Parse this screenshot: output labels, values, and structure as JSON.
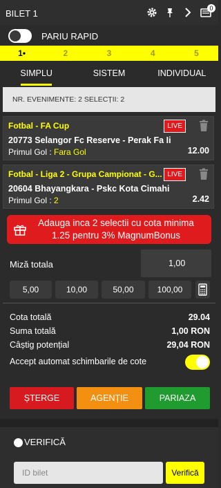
{
  "header": {
    "title": "BILET 1",
    "badge": "0"
  },
  "rapid": {
    "label": "PARIU RAPID",
    "on": false
  },
  "steps": [
    "1•",
    "2",
    "3",
    "4",
    "5"
  ],
  "tabs": [
    "SIMPLU",
    "SISTEM",
    "INDIVIDUAL"
  ],
  "summary": "NR. EVENIMENTE: 2   SELECȚII: 2",
  "bets": [
    {
      "competition": "Fotbal - FA Cup",
      "live": "LIVE",
      "match": "20773  Selangor Fc Reserve  -  Perak Fa Ii",
      "market": "Primul Gol :",
      "selection": "Fara Gol",
      "odd": "12.00"
    },
    {
      "competition": "Fotbal - Liga 2 - Grupa Campionat - G...",
      "live": "LIVE",
      "match": "20604  Bhayangkara  -  Pskc Kota Cimahi",
      "market": "Primul Gol :",
      "selection": "2",
      "odd": "2.42"
    }
  ],
  "promo": {
    "line1": "Adauga inca 2 selectii cu cota minima",
    "line2": "1.25 pentru 3% MagnumBonus"
  },
  "stake": {
    "label": "Miză totala",
    "value": "1,00"
  },
  "quick_stakes": [
    "5,00",
    "10,00",
    "50,00",
    "100,00"
  ],
  "totals": {
    "cota_label": "Cota totală",
    "cota_value": "29.04",
    "suma_label": "Suma totală",
    "suma_value": "1,00 RON",
    "castig_label": "Câștig potențial",
    "castig_value": "29,04 RON",
    "accept_label": "Accept automat schimbarile de cote"
  },
  "actions": {
    "delete": "ȘTERGE",
    "agency": "AGENȚIE",
    "bet": "PARIAZA"
  },
  "verify": {
    "label": "VERIFICĂ",
    "placeholder": "ID bilet",
    "button": "Verifică"
  },
  "colors": {
    "accent": "#ffff00",
    "live": "#e2191c",
    "delete": "#d61a1f",
    "agency": "#f39012",
    "bet": "#1f9b2f"
  }
}
